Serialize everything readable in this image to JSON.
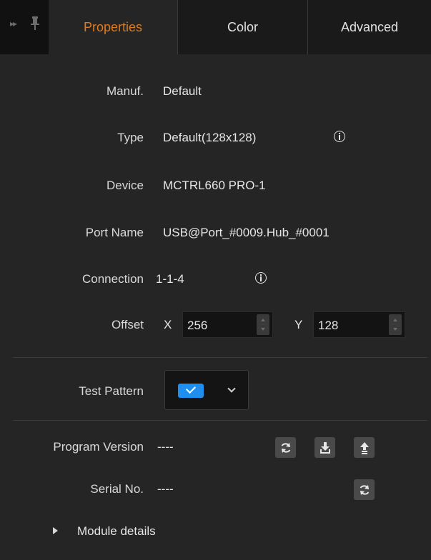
{
  "tabs": [
    {
      "label": "Properties",
      "active": true
    },
    {
      "label": "Color",
      "active": false
    },
    {
      "label": "Advanced",
      "active": false
    }
  ],
  "toolbar_icons": {
    "collapse": "double-chevron-right-icon",
    "pin": "pin-icon"
  },
  "properties": {
    "manuf_label": "Manuf.",
    "manuf_value": "Default",
    "type_label": "Type",
    "type_value": "Default(128x128)",
    "device_label": "Device",
    "device_value": "MCTRL660 PRO-1",
    "port_label": "Port Name",
    "port_value": "USB@Port_#0009.Hub_#0001",
    "connection_label": "Connection",
    "connection_value": "1-1-4",
    "offset_label": "Offset",
    "offset_x_label": "X",
    "offset_x_value": "256",
    "offset_y_label": "Y",
    "offset_y_value": "128"
  },
  "test_pattern": {
    "label": "Test Pattern",
    "checked": true
  },
  "program_version": {
    "label": "Program Version",
    "value": "----"
  },
  "serial_no": {
    "label": "Serial No.",
    "value": "----"
  },
  "module_details": {
    "label": "Module details"
  },
  "colors": {
    "accent": "#e07a1f",
    "check_blue": "#1e8fef",
    "background": "#252525"
  }
}
